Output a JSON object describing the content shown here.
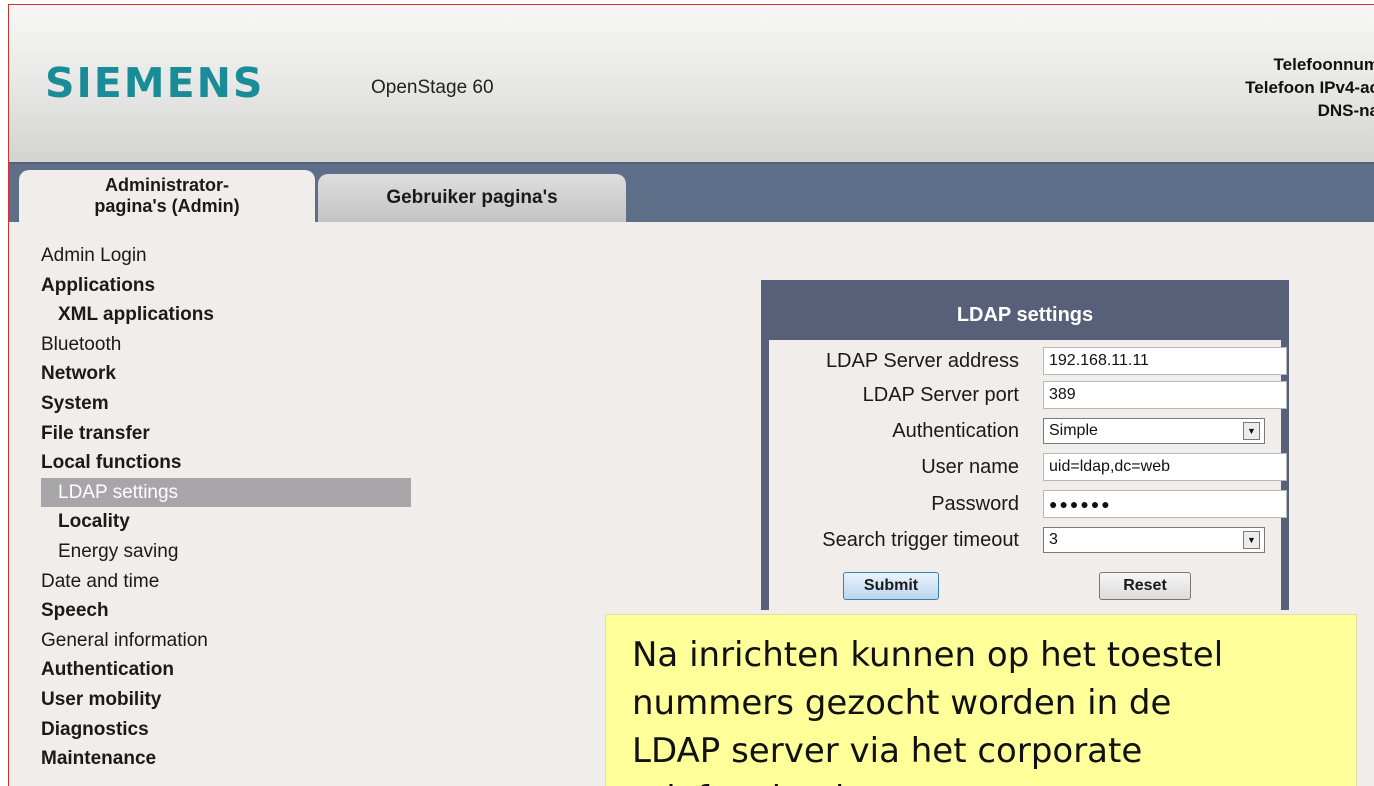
{
  "header": {
    "brand": "SIEMENS",
    "model": "OpenStage 60",
    "info_lines": [
      "Telefoonnum",
      "Telefoon IPv4-ac",
      "DNS-na"
    ]
  },
  "tabs": [
    {
      "label": "Administrator-\npagina's (Admin)",
      "active": true
    },
    {
      "label": "Gebruiker pagina's",
      "active": false
    }
  ],
  "nav": {
    "items": [
      {
        "label": "Admin Login",
        "bold": false,
        "indent": false
      },
      {
        "label": "Applications",
        "bold": true,
        "indent": false
      },
      {
        "label": "XML applications",
        "bold": true,
        "indent": true
      },
      {
        "label": "Bluetooth",
        "bold": false,
        "indent": false
      },
      {
        "label": "Network",
        "bold": true,
        "indent": false
      },
      {
        "label": "System",
        "bold": true,
        "indent": false
      },
      {
        "label": "File transfer",
        "bold": true,
        "indent": false
      },
      {
        "label": "Local functions",
        "bold": true,
        "indent": false
      },
      {
        "label": "LDAP settings",
        "bold": false,
        "indent": true,
        "selected": true
      },
      {
        "label": "Locality",
        "bold": true,
        "indent": true
      },
      {
        "label": "Energy saving",
        "bold": false,
        "indent": true
      },
      {
        "label": "Date and time",
        "bold": false,
        "indent": false
      },
      {
        "label": "Speech",
        "bold": true,
        "indent": false
      },
      {
        "label": "General information",
        "bold": false,
        "indent": false
      },
      {
        "label": "Authentication",
        "bold": true,
        "indent": false
      },
      {
        "label": "User mobility",
        "bold": true,
        "indent": false
      },
      {
        "label": "Diagnostics",
        "bold": true,
        "indent": false
      },
      {
        "label": "Maintenance",
        "bold": true,
        "indent": false
      }
    ]
  },
  "ldap": {
    "title": "LDAP settings",
    "server_address_label": "LDAP Server address",
    "server_address_value": "192.168.11.11",
    "server_port_label": "LDAP Server port",
    "server_port_value": "389",
    "authentication_label": "Authentication",
    "authentication_value": "Simple",
    "user_name_label": "User name",
    "user_name_value": "uid=ldap,dc=web",
    "password_label": "Password",
    "password_value": "●●●●●●",
    "timeout_label": "Search trigger timeout",
    "timeout_value": "3",
    "submit_label": "Submit",
    "reset_label": "Reset"
  },
  "callout": {
    "lines": [
      "Na inrichten kunnen op het toestel",
      "nummers gezocht worden in de",
      "LDAP server via het corporate",
      "telefoonboek"
    ]
  },
  "colors": {
    "brand": "#1a8c97",
    "tabbar": "#5d6e88",
    "panel_header": "#585f78",
    "selected_nav": "#a7a5a7",
    "callout_bg": "#ffff99"
  }
}
